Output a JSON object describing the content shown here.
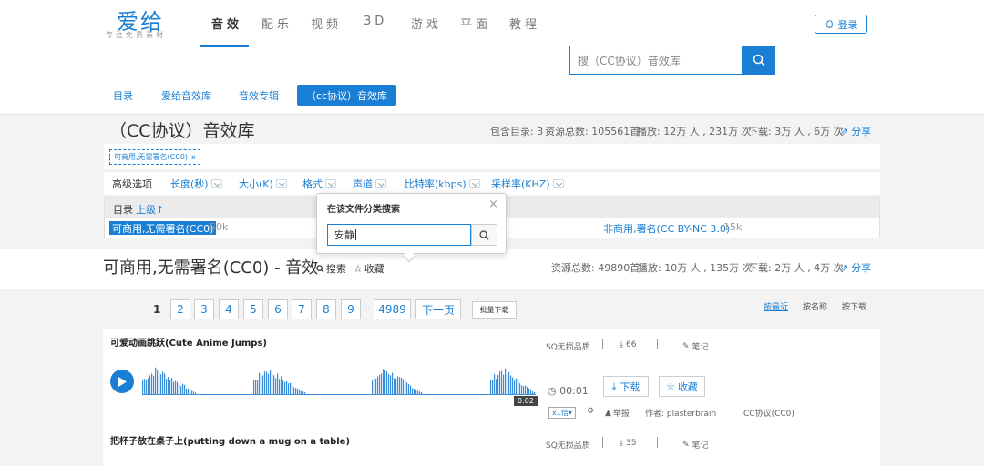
{
  "header": {
    "logo": "爱给",
    "logo_sub": "专注免费素材",
    "nav": [
      "音效",
      "配乐",
      "视频",
      "3D",
      "游戏",
      "平面",
      "教程"
    ],
    "login": "登录",
    "search_placeholder": "搜（CC协议）音效库"
  },
  "subnav": {
    "items": [
      "目录",
      "爱给音效库",
      "音效专辑"
    ],
    "active": "（cc协议）音效库"
  },
  "library": {
    "title": "（CC协议）音效库",
    "stats": {
      "dirs": "包含目录: 3",
      "total": "资源总数: 105561首",
      "plays": "播放: 12万 人 , 231万 次",
      "downloads": "下载: 3万 人 , 6万 次",
      "share": "分享"
    },
    "tag": "可商用,无需署名(CC0)",
    "tag_close": "x",
    "advanced": "高级选项",
    "filters": [
      "长度(秒)",
      "大小(K)",
      "格式",
      "声道",
      "比特率(kbps)",
      "采样率(KHZ)"
    ],
    "dir_label": "目录",
    "dir_up": "上级↑",
    "dir_active": "可商用,无需署名(CC0)",
    "dir_active_count": "50k",
    "dir_other": "非商用,署名(CC BY-NC 3.0)",
    "dir_other_count": "15k"
  },
  "popup": {
    "title": "在该文件分类搜索",
    "close": "×",
    "value": "安静"
  },
  "folder": {
    "title": "可商用,无需署名(CC0) - 音效",
    "search": "搜索",
    "collect": "收藏",
    "stats": {
      "total": "资源总数: 49890首",
      "plays": "播放: 10万 人 , 135万 次",
      "downloads": "下载: 2万 人 , 4万 次",
      "share": "分享"
    }
  },
  "pagination": {
    "current": "1",
    "pages": [
      "2",
      "3",
      "4",
      "5",
      "6",
      "7",
      "8",
      "9"
    ],
    "ellipsis": "···",
    "last": "4989",
    "next": "下一页",
    "batch": "批量下载"
  },
  "sort": [
    "按最近",
    "按名称",
    "按下载"
  ],
  "items": [
    {
      "title": "可爱动画跳跃(Cute Anime Jumps)",
      "quality": "SQ无损品质",
      "downloads": "66",
      "note": "笔记",
      "duration": "0:02",
      "time": "00:01",
      "download_btn": "下载",
      "fav_btn": "收藏",
      "speed": "x1倍",
      "report": "举报",
      "author": "作者: plasterbrain",
      "license": "CC协议(CC0)"
    },
    {
      "title": "把杯子放在桌子上(putting down a mug on a table)",
      "quality": "SQ无损品质",
      "downloads": "35",
      "note": "笔记"
    }
  ],
  "colors": {
    "accent": "#1a7fd4",
    "band": "#f3f3f3"
  }
}
